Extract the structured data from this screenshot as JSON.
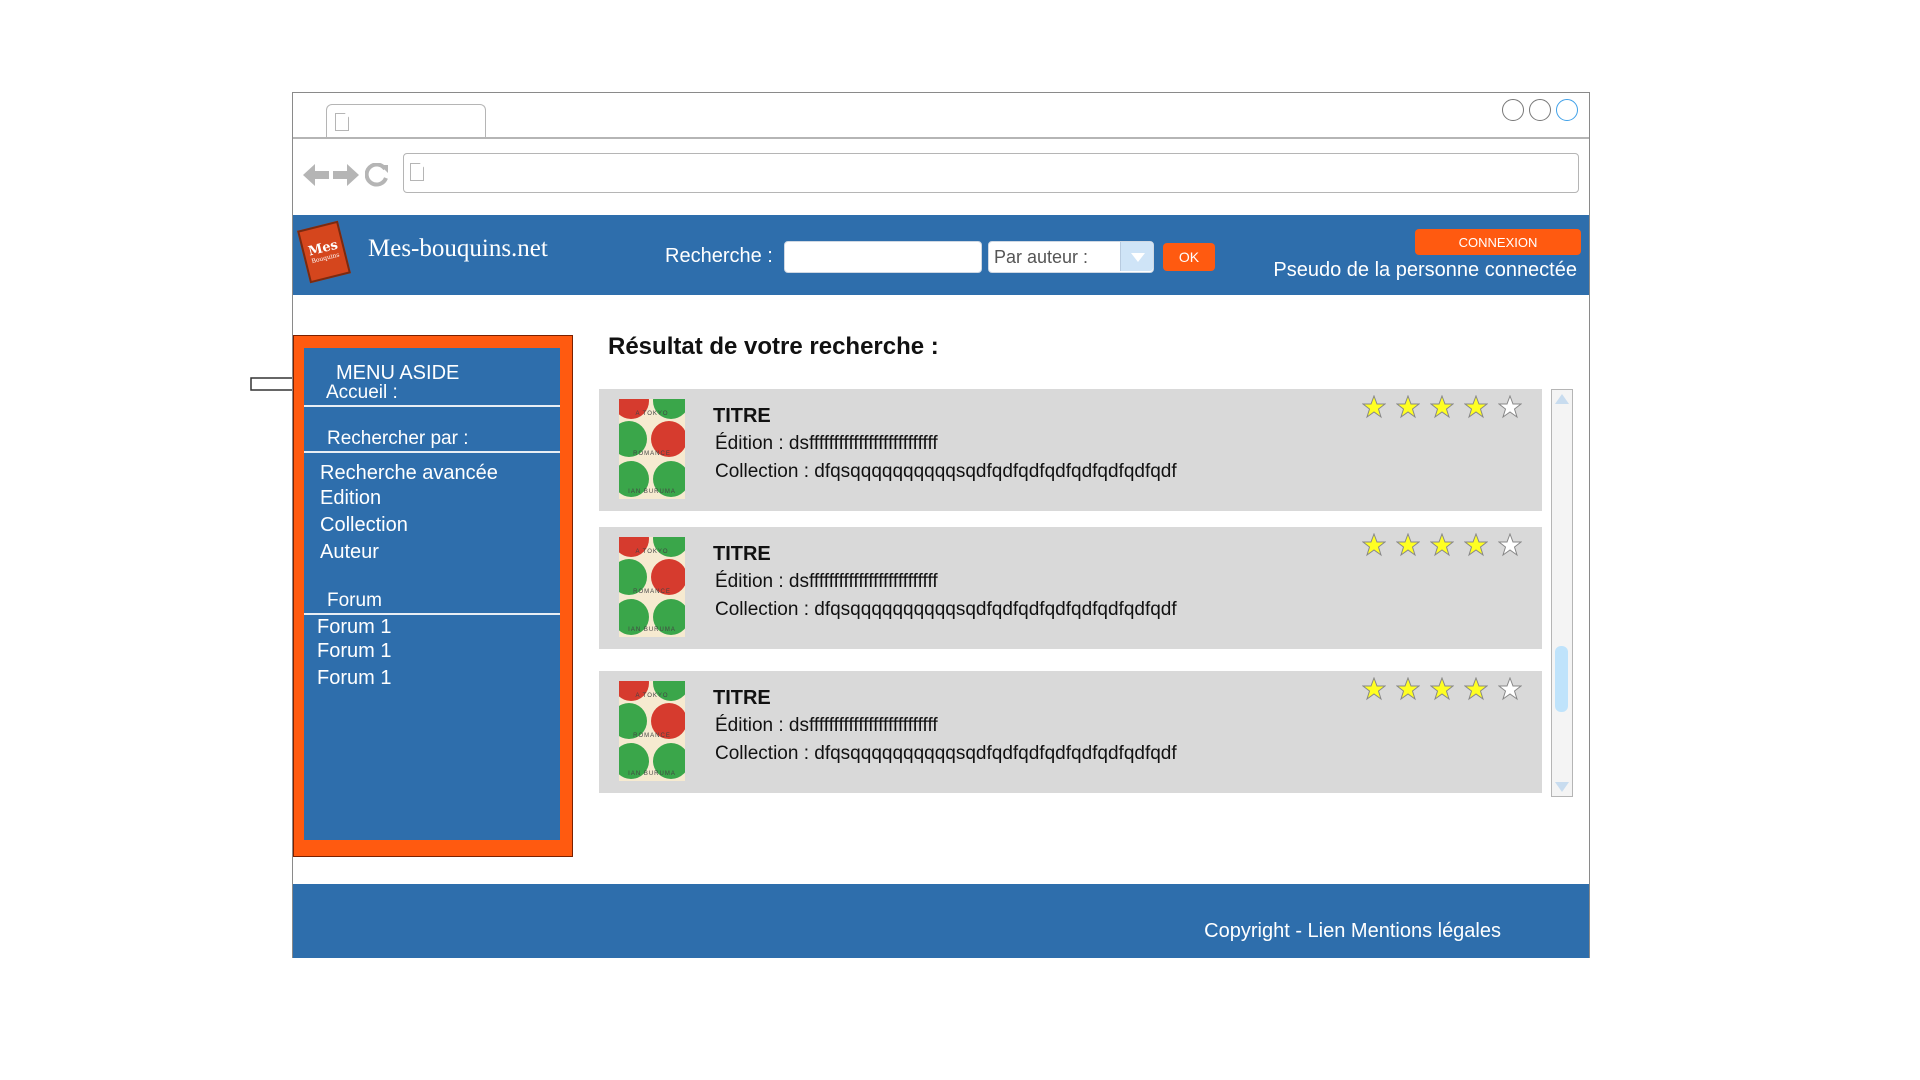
{
  "window": {
    "controls": [
      "minimize",
      "maximize",
      "close"
    ]
  },
  "browser_nav": {
    "icons": [
      "back-arrow-icon",
      "forward-arrow-icon",
      "reload-icon"
    ]
  },
  "header": {
    "logo_text_top": "Mes",
    "logo_text_bottom": "Bouquins",
    "site_name": "Mes-bouquins.net",
    "search_label": "Recherche :",
    "search_value": "",
    "filter_selected": "Par auteur :",
    "ok_label": "OK",
    "login_label": "CONNEXION",
    "username": "Pseudo de la personne connectée"
  },
  "aside": {
    "heading": "MENU ASIDE",
    "home": "Accueil :",
    "search_by": "Rechercher par :",
    "search_items": [
      "Recherche avancée",
      "Edition",
      "Collection",
      "Auteur"
    ],
    "forum_heading": "Forum",
    "forum_items": [
      "Forum 1",
      "Forum 1",
      "Forum 1"
    ]
  },
  "results": {
    "title": "Résultat de votre recherche :",
    "items": [
      {
        "title": "TITRE",
        "edition": "Édition : dsffffffffffffffffffffffffff",
        "collection": "Collection : dfqsqqqqqqqqqqsqdfqdfqdfqdfqdfqdfqdfqdf",
        "rating": 4,
        "max_rating": 5,
        "cover": {
          "top": "A TOKYO",
          "middle": "ROMANCE",
          "bottom": "IAN BURUMA"
        }
      },
      {
        "title": "TITRE",
        "edition": "Édition : dsffffffffffffffffffffffffff",
        "collection": "Collection : dfqsqqqqqqqqqqsqdfqdfqdfqdfqdfqdfqdfqdf",
        "rating": 4,
        "max_rating": 5,
        "cover": {
          "top": "A TOKYO",
          "middle": "ROMANCE",
          "bottom": "IAN BURUMA"
        }
      },
      {
        "title": "TITRE",
        "edition": "Édition : dsffffffffffffffffffffffffff",
        "collection": "Collection : dfqsqqqqqqqqqqsqdfqdfqdfqdfqdfqdfqdfqdf",
        "rating": 4,
        "max_rating": 5,
        "cover": {
          "top": "A TOKYO",
          "middle": "ROMANCE",
          "bottom": "IAN BURUMA"
        }
      }
    ]
  },
  "footer": {
    "text": "Copyright - Lien Mentions légales"
  },
  "colors": {
    "brand_blue": "#2e6eac",
    "accent_orange": "#ff5a10",
    "card_gray": "#d9d9d9",
    "star_fill": "#ffff22"
  }
}
